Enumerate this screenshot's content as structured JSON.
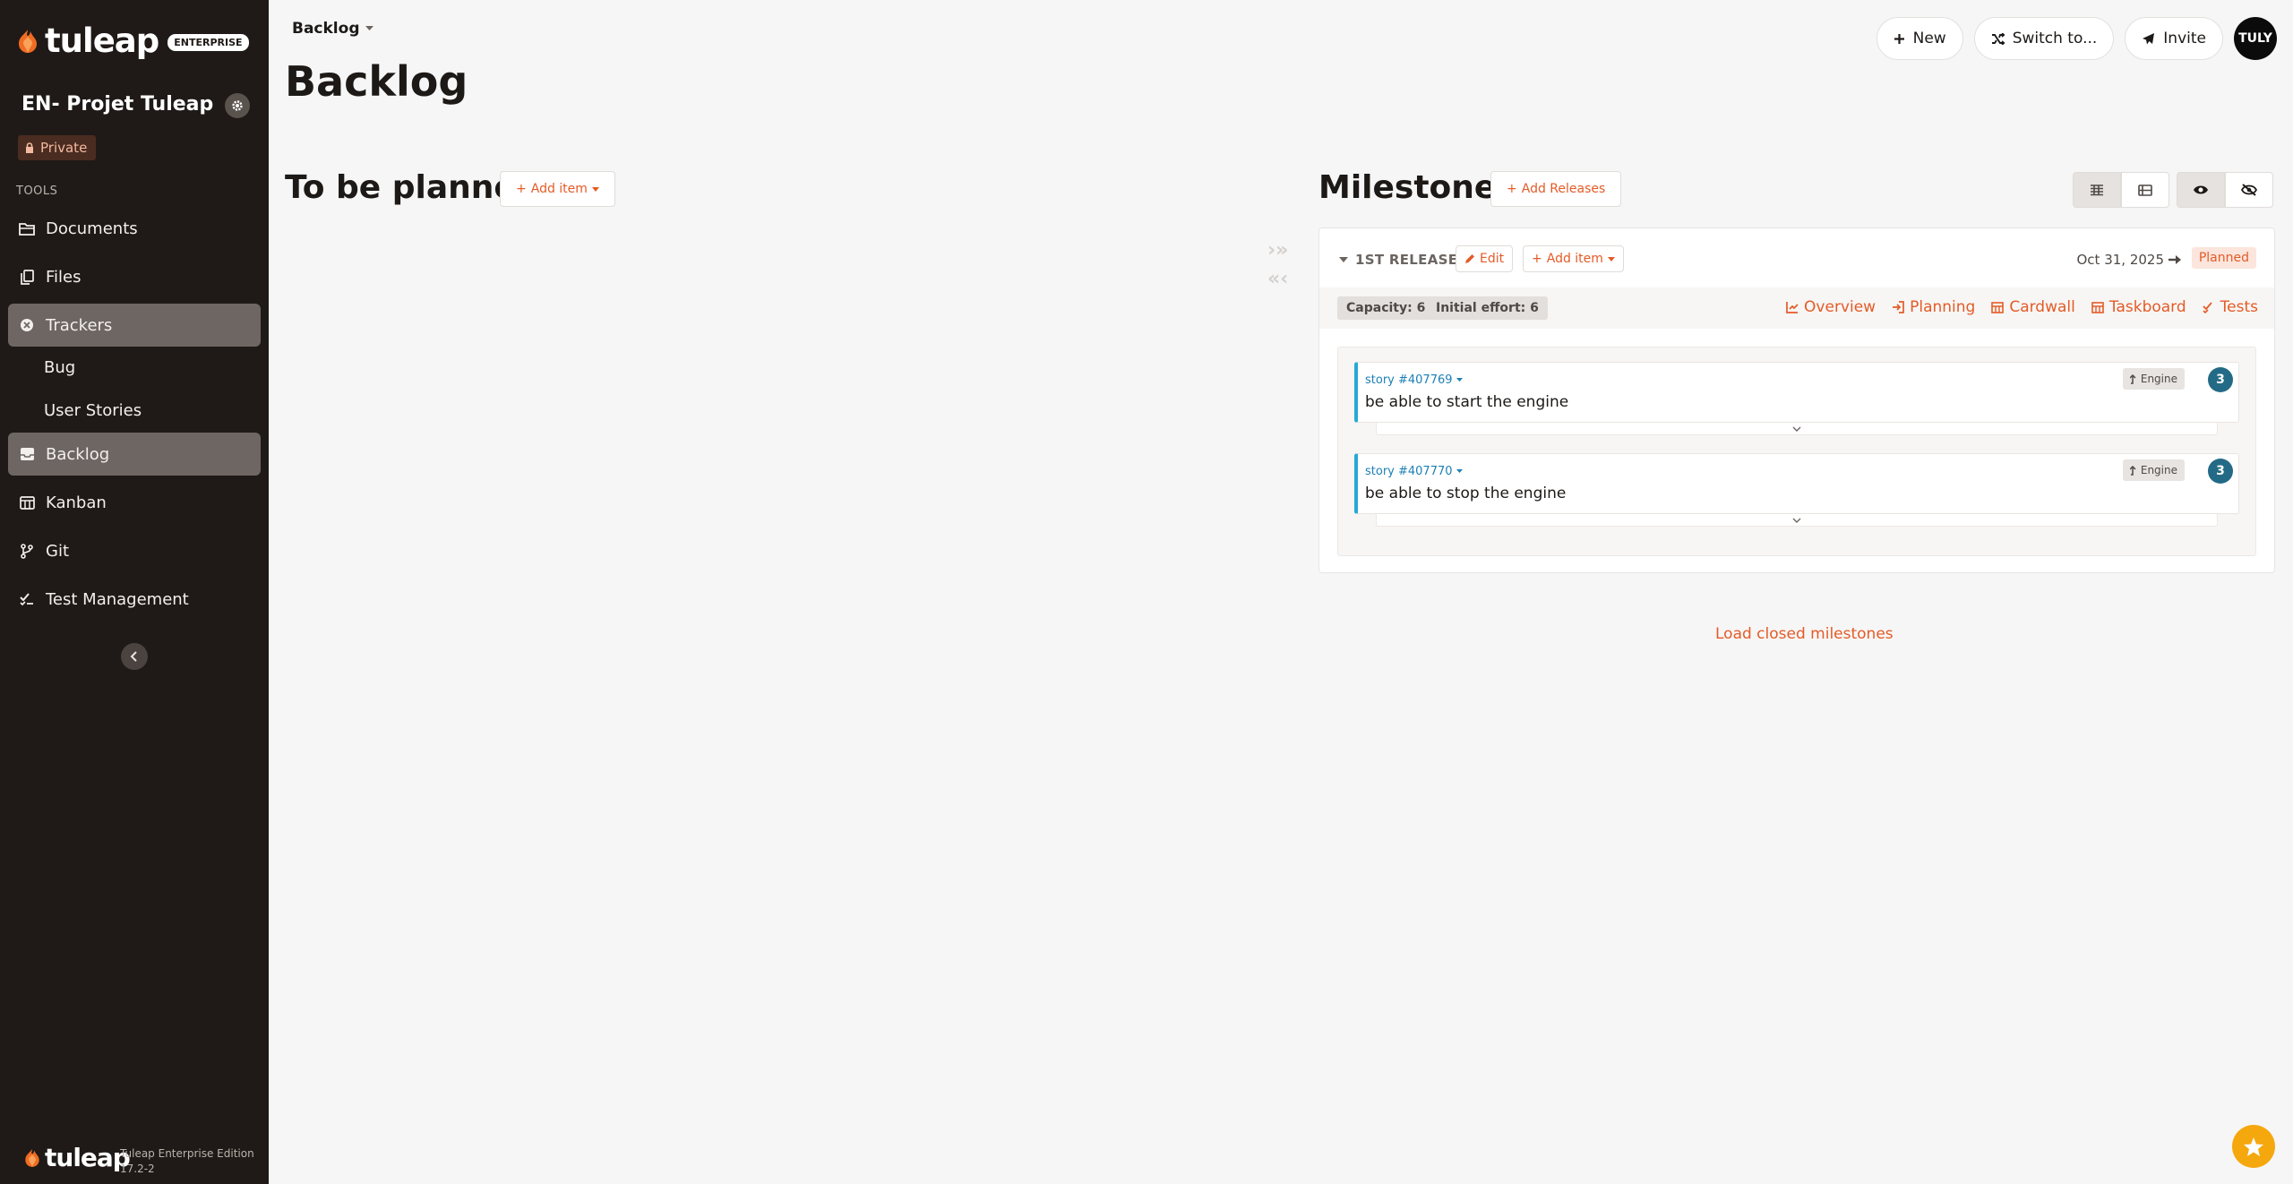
{
  "sidebar": {
    "logo_text": "tuleap",
    "edition_badge": "ENTERPRISE",
    "project_name": "EN- Projet Tuleap",
    "privacy": "Private",
    "tools_label": "TOOLS",
    "items": [
      {
        "label": "Documents",
        "icon": "folder-icon"
      },
      {
        "label": "Files",
        "icon": "files-icon"
      },
      {
        "label": "Trackers",
        "icon": "tracker-icon",
        "active": true
      },
      {
        "label": "Bug",
        "sub": true
      },
      {
        "label": "User Stories",
        "sub": true
      },
      {
        "label": "Backlog",
        "icon": "inbox-icon",
        "active": true
      },
      {
        "label": "Kanban",
        "icon": "kanban-icon"
      },
      {
        "label": "Git",
        "icon": "git-branch-icon"
      },
      {
        "label": "Test Management",
        "icon": "check-icon"
      }
    ],
    "footer_logo": "tuleap",
    "footer_edition": "Tuleap Enterprise Edition",
    "footer_version": "17.2-2"
  },
  "header": {
    "breadcrumb": "Backlog",
    "title": "Backlog",
    "buttons": {
      "new": "New",
      "switch": "Switch to...",
      "invite": "Invite"
    },
    "avatar": "TULY"
  },
  "to_be_planned": {
    "title": "To be planned",
    "add_item": "Add item"
  },
  "milestones": {
    "title": "Milestones",
    "add_releases": "Add Releases",
    "load_closed": "Load closed milestones",
    "release": {
      "name": "1ST RELEASE",
      "edit": "Edit",
      "add_item": "Add item",
      "date": "Oct 31, 2025",
      "status": "Planned",
      "capacity": "Capacity: 6",
      "initial_effort": "Initial effort: 6",
      "links": [
        "Overview",
        "Planning",
        "Cardwall",
        "Taskboard",
        "Tests"
      ]
    },
    "items": [
      {
        "id": "story #407769",
        "title": "be able to start the engine",
        "tag": "Engine",
        "effort": "3"
      },
      {
        "id": "story #407770",
        "title": "be able to stop the engine",
        "tag": "Engine",
        "effort": "3"
      }
    ]
  },
  "colors": {
    "accent": "#e45b27",
    "sidebar_bg": "#1f1a17",
    "card_border": "#28a9d4",
    "effort_badge": "#236a86"
  }
}
